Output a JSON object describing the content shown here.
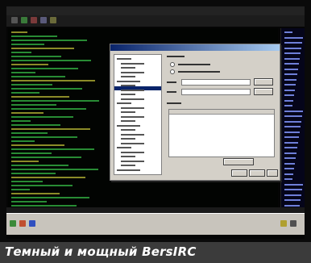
{
  "caption": {
    "text": "Темный и мощный BersIRC"
  },
  "colors": {
    "chat_text": "#2c9a3a",
    "chat_text_alt": "#9a9a2c",
    "nick_list_text": "#6e7fd8",
    "dialog_bg": "#d4d0c8",
    "dialog_title": "#0a246a",
    "caption_bar": "#3b3b3b",
    "caption_text": "#ffffff"
  },
  "icons": [
    "app-menu-icon",
    "connect-icon",
    "disconnect-icon",
    "settings-icon",
    "channels-icon",
    "start-icon",
    "tray-icon"
  ]
}
